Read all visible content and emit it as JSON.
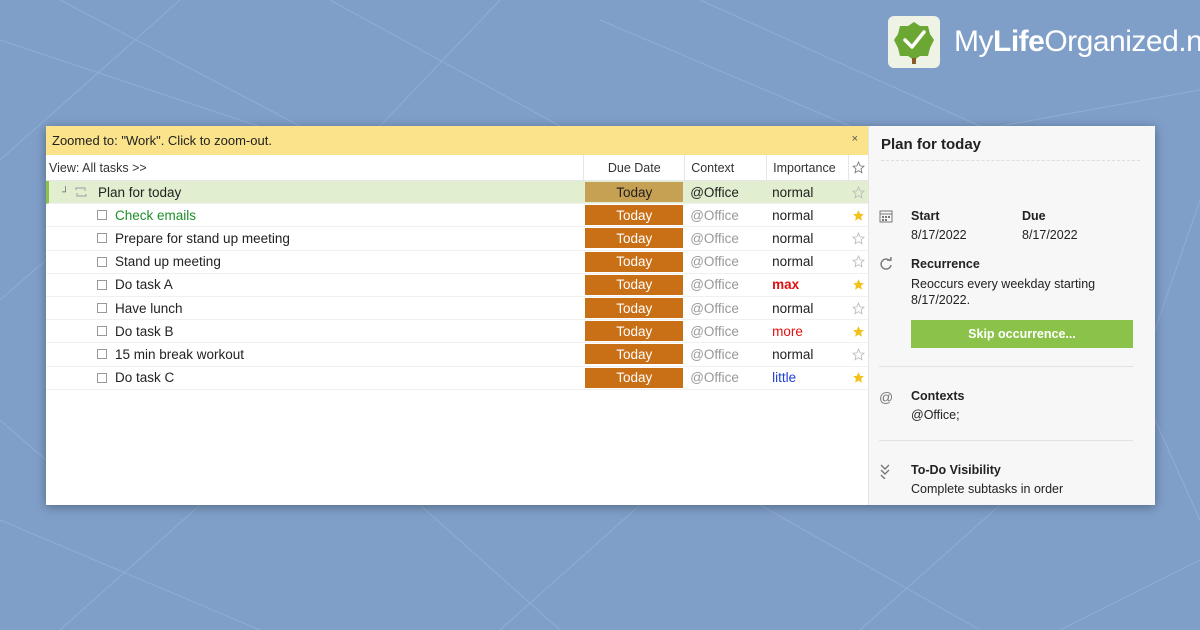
{
  "brand": {
    "name_part1": "My",
    "name_part2": "Life",
    "name_part3": "Organized",
    "name_part4": ".net",
    "logo_icon": "tree-check-icon",
    "accent": "#7cb342"
  },
  "zoom_bar": {
    "text": "Zoomed to: \"Work\". Click to zoom-out.",
    "close_label": "×"
  },
  "header": {
    "view_label": "View: All tasks >>",
    "due_date": "Due Date",
    "context": "Context",
    "importance": "Importance",
    "star_icon": "star-outline-icon"
  },
  "parent_task": {
    "name": "Plan for today",
    "due": "Today",
    "context": "@Office",
    "importance": "normal",
    "starred": false
  },
  "tasks": [
    {
      "name": "Check emails",
      "due": "Today",
      "context": "@Office",
      "importance": "normal",
      "importance_style": "normal",
      "starred": true,
      "highlight": "green"
    },
    {
      "name": "Prepare for stand up meeting",
      "due": "Today",
      "context": "@Office",
      "importance": "normal",
      "importance_style": "normal",
      "starred": false
    },
    {
      "name": "Stand up meeting",
      "due": "Today",
      "context": "@Office",
      "importance": "normal",
      "importance_style": "normal",
      "starred": false
    },
    {
      "name": "Do task A",
      "due": "Today",
      "context": "@Office",
      "importance": "max",
      "importance_style": "max",
      "starred": true
    },
    {
      "name": "Have lunch",
      "due": "Today",
      "context": "@Office",
      "importance": "normal",
      "importance_style": "normal",
      "starred": false
    },
    {
      "name": "Do task B",
      "due": "Today",
      "context": "@Office",
      "importance": "more",
      "importance_style": "more",
      "starred": true
    },
    {
      "name": "15 min break workout",
      "due": "Today",
      "context": "@Office",
      "importance": "normal",
      "importance_style": "normal",
      "starred": false
    },
    {
      "name": "Do task C",
      "due": "Today",
      "context": "@Office",
      "importance": "little",
      "importance_style": "little",
      "starred": true
    }
  ],
  "details": {
    "title": "Plan for today",
    "start_label": "Start",
    "start_value": "8/17/2022",
    "due_label": "Due",
    "due_value": "8/17/2022",
    "recurrence_label": "Recurrence",
    "recurrence_text": "Reoccurs every weekday starting 8/17/2022.",
    "skip_button": "Skip occurrence...",
    "contexts_label": "Contexts",
    "contexts_value": "@Office;",
    "visibility_label": "To-Do Visibility",
    "visibility_value": "Complete subtasks in order"
  },
  "colors": {
    "background": "#7f9fc9",
    "zoom_bar": "#fae38a",
    "due_today": "#c96f16",
    "parent_due": "#c6a053",
    "parent_row": "#e1efd0",
    "skip_button": "#8bc34a",
    "star": "#f2c21b"
  }
}
